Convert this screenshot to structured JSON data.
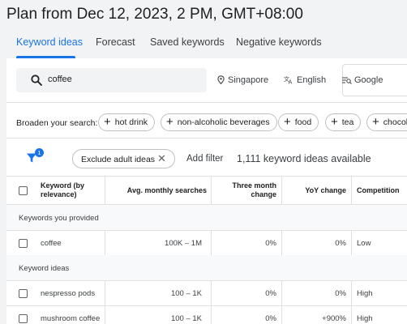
{
  "page_title": "Plan from Dec 12, 2023, 2 PM, GMT+08:00",
  "tabs": [
    {
      "label": "Keyword ideas",
      "active": true
    },
    {
      "label": "Forecast",
      "active": false
    },
    {
      "label": "Saved keywords",
      "active": false
    },
    {
      "label": "Negative keywords",
      "active": false
    }
  ],
  "search": {
    "value": "coffee",
    "icon": "search-icon"
  },
  "targeting": {
    "location": "Singapore",
    "language": "English",
    "network": "Google"
  },
  "broaden": {
    "label": "Broaden your search:",
    "chips": [
      "hot drink",
      "non-alcoholic beverages",
      "food",
      "tea",
      "chocolate"
    ]
  },
  "filters": {
    "badge_count": "1",
    "exclude_chip": "Exclude adult ideas",
    "add_filter": "Add filter",
    "ideas_available": "1,111 keyword ideas available"
  },
  "table": {
    "columns": {
      "keyword": "Keyword (by relevance)",
      "avg_searches": "Avg. monthly searches",
      "three_month": "Three month change",
      "yoy": "YoY change",
      "competition": "Competition"
    },
    "section_provided": "Keywords you provided",
    "section_ideas": "Keyword ideas",
    "rows": [
      {
        "keyword": "coffee",
        "avg": "100K – 1M",
        "three": "0%",
        "yoy": "0%",
        "competition": "Low"
      },
      {
        "keyword": "nespresso pods",
        "avg": "100 – 1K",
        "three": "0%",
        "yoy": "0%",
        "competition": "High"
      },
      {
        "keyword": "mushroom coffee",
        "avg": "100 – 1K",
        "three": "0%",
        "yoy": "+900%",
        "competition": "High"
      }
    ]
  },
  "colors": {
    "accent": "#1a73e8",
    "background": "#f1f3f4"
  }
}
